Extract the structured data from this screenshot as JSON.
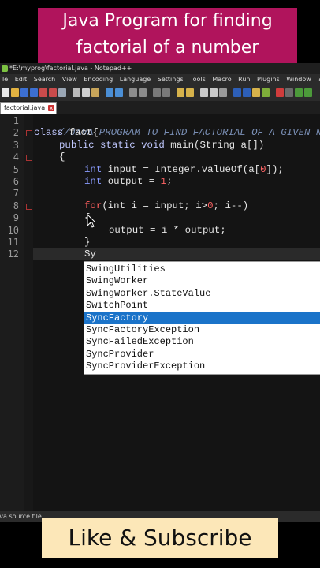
{
  "banner": {
    "line1": "Java Program for finding",
    "line2": "factorial of a number"
  },
  "window": {
    "title": "*E:\\myprog\\factorial.java - Notepad++"
  },
  "menu": [
    "le",
    "Edit",
    "Search",
    "View",
    "Encoding",
    "Language",
    "Settings",
    "Tools",
    "Macro",
    "Run",
    "Plugins",
    "Window",
    "?"
  ],
  "tab": {
    "label": "factorial.java",
    "close": "x"
  },
  "editor": {
    "line_numbers": [
      "1",
      "2",
      "3",
      "4",
      "5",
      "6",
      "7",
      "8",
      "9",
      "10",
      "11",
      "12"
    ],
    "lines": [
      {
        "comment": "//JAVA PROGRAM TO FIND FACTORIAL OF A GIVEN NO"
      },
      {
        "kw": "class",
        "text": " fact{"
      },
      {
        "kw": "public static void",
        "text": " main(String a[])"
      },
      {
        "text": "{"
      },
      {
        "type": "int",
        "text": " input = Integer.valueOf(a[",
        "num": "0",
        "text2": "]);"
      },
      {
        "type": "int",
        "text": " output = ",
        "num": "1",
        "text2": ";"
      },
      {
        "for": "for",
        "text": "(int i = input; i>",
        "num": "0",
        "text2": "; i--)"
      },
      {
        "text": "{"
      },
      {
        "text": "output = i * output;"
      },
      {
        "text": "}"
      },
      {
        "text": "Sy"
      }
    ]
  },
  "autocomplete": {
    "items": [
      "SwingUtilities",
      "SwingWorker",
      "SwingWorker.StateValue",
      "SwitchPoint",
      "SyncFactory",
      "SyncFactoryException",
      "SyncFailedException",
      "SyncProvider",
      "SyncProviderException"
    ],
    "selected": "SyncFactory"
  },
  "status": {
    "file_type": "Java source file"
  },
  "footer": {
    "cta": "Like & Subscribe"
  },
  "colors": {
    "banner_bg": "#b0145c",
    "cta_bg": "#fce7b8",
    "selection": "#1a73c9"
  }
}
